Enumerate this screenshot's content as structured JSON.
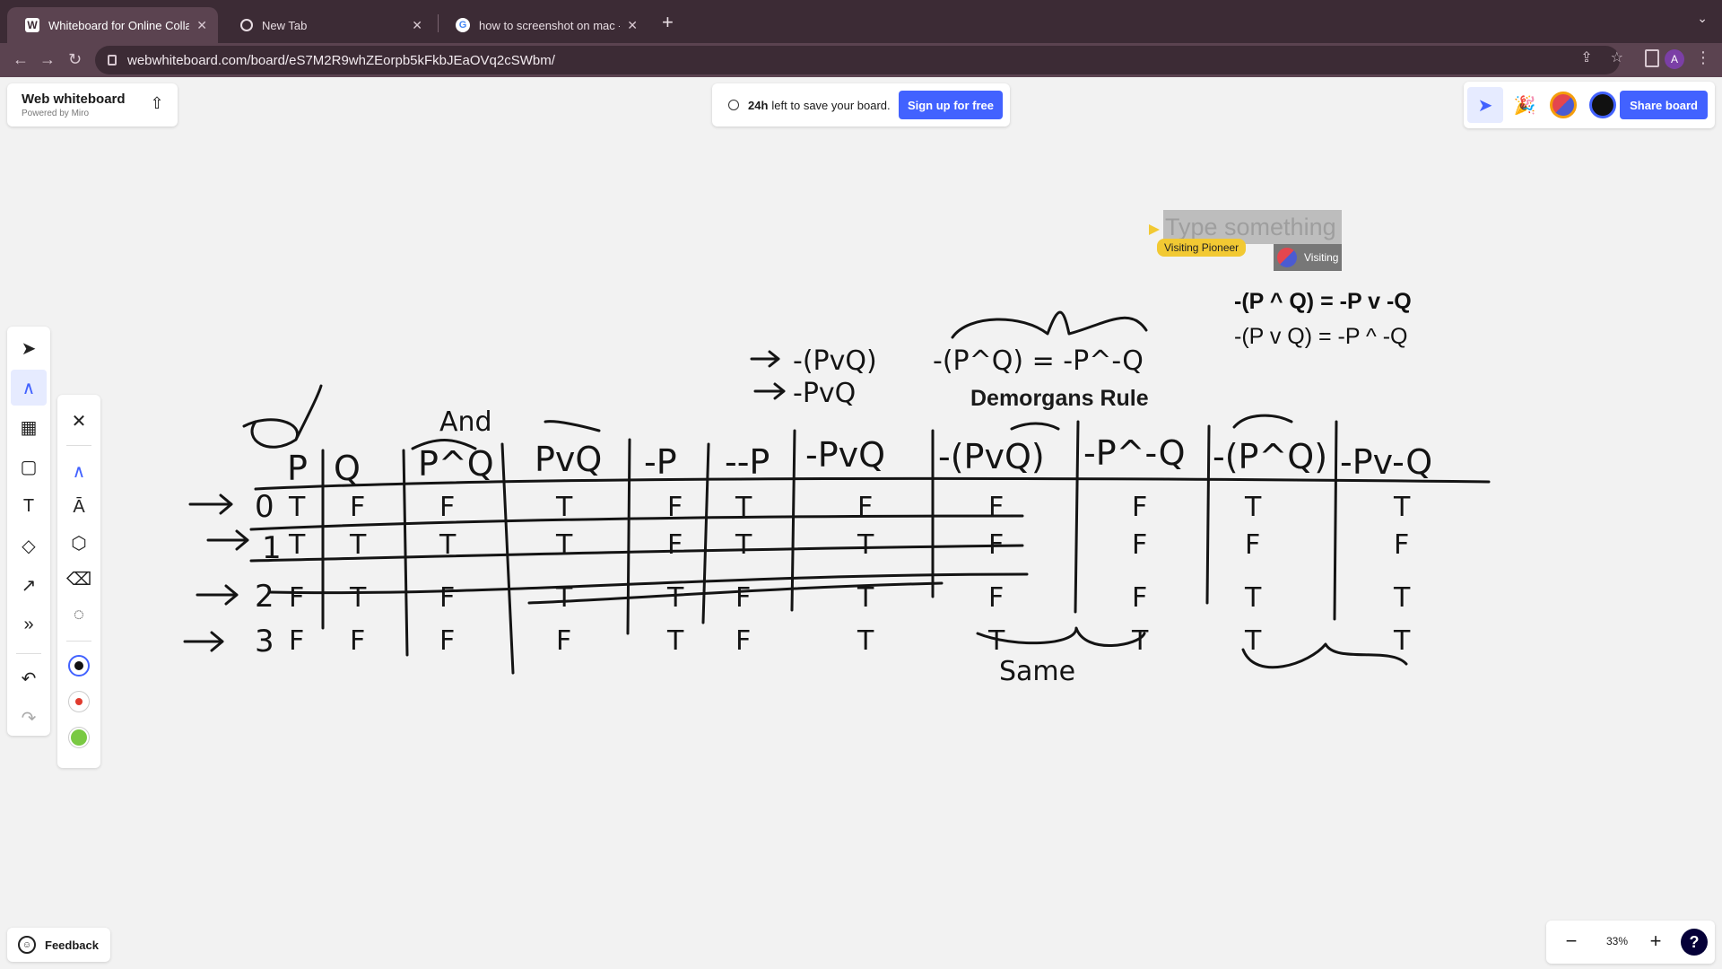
{
  "browser": {
    "tabs": [
      {
        "title": "Whiteboard for Online Collabo",
        "favicon": "W",
        "active": true
      },
      {
        "title": "New Tab",
        "favicon": "chrome-icon",
        "active": false
      },
      {
        "title": "how to screenshot on mac - G",
        "favicon": "google-icon",
        "active": false
      }
    ],
    "new_tab": "+",
    "url": "webwhiteboard.com/board/eS7M2R9whZEorpb5kFkbJEaOVq2cSWbm/",
    "profile_initial": "A"
  },
  "app": {
    "brand_name": "Web whiteboard",
    "brand_sub": "Powered by Miro",
    "notice_bold": "24h",
    "notice_text": "left to save your board.",
    "signup_label": "Sign up for free",
    "share_label": "Share board",
    "feedback_label": "Feedback",
    "zoom_value": "33%",
    "help": "?",
    "accent": "#4262ff"
  },
  "board": {
    "type_placeholder": "Type something",
    "cursor_name": "Visiting Pioneer",
    "visitor_badge": "Visiting",
    "eq_and": "-(P ^ Q) = -P v -Q",
    "eq_or": "-(P v Q) = -P ^ -Q",
    "rule_title": "Demorgans Rule",
    "handwriting": {
      "headers": [
        "P",
        "Q",
        "P^Q",
        "PvQ",
        "-P",
        "--P",
        "-PvQ",
        "-(PvQ)",
        "-P^-Q",
        "-(P^Q)",
        "-Pv-Q"
      ],
      "and_note": "And",
      "arrow_notes": [
        "-(PvQ)",
        "-PvQ"
      ],
      "top_note": "-(P^Q) = -P^-Q",
      "same_note": "Same",
      "row_indices": [
        "0",
        "1",
        "2",
        "3"
      ],
      "rows": [
        [
          "T",
          "F",
          "F",
          "T",
          "F",
          "T",
          "F",
          "F",
          "F",
          "T",
          "T"
        ],
        [
          "T",
          "T",
          "T",
          "T",
          "F",
          "T",
          "T",
          "F",
          "F",
          "F",
          "F"
        ],
        [
          "F",
          "T",
          "F",
          "T",
          "T",
          "F",
          "T",
          "F",
          "F",
          "T",
          "T"
        ],
        [
          "F",
          "F",
          "F",
          "F",
          "T",
          "F",
          "T",
          "T",
          "T",
          "T",
          "T"
        ]
      ]
    }
  }
}
